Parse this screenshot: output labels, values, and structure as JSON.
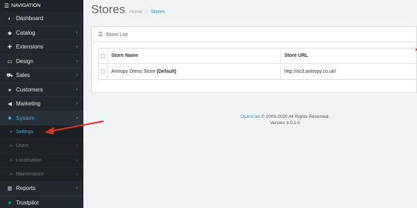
{
  "nav": {
    "header": "NAVIGATION",
    "items": [
      {
        "label": "Dashboard",
        "icon": "dashboard-icon",
        "glyph": "◐",
        "chevron": ""
      },
      {
        "label": "Catalog",
        "icon": "tag-icon",
        "glyph": "◆",
        "chevron": "›"
      },
      {
        "label": "Extensions",
        "icon": "puzzle-icon",
        "glyph": "✚",
        "chevron": "›"
      },
      {
        "label": "Design",
        "icon": "monitor-icon",
        "glyph": "▭",
        "chevron": "›"
      },
      {
        "label": "Sales",
        "icon": "cart-icon",
        "glyph": "⛟",
        "chevron": "›"
      },
      {
        "label": "Customers",
        "icon": "user-icon",
        "glyph": "●",
        "chevron": "›"
      },
      {
        "label": "Marketing",
        "icon": "share-icon",
        "glyph": "◀",
        "chevron": "›"
      },
      {
        "label": "System",
        "icon": "gear-icon",
        "glyph": "✹",
        "chevron": "›"
      }
    ],
    "system_sub": [
      {
        "label": "Settings",
        "chevron": ""
      },
      {
        "label": "Users",
        "chevron": "›"
      },
      {
        "label": "Localisation",
        "chevron": "›"
      },
      {
        "label": "Maintenance",
        "chevron": "›"
      }
    ],
    "bottom": [
      {
        "label": "Reports",
        "icon": "bar-chart-icon",
        "glyph": "▥",
        "chevron": "›"
      },
      {
        "label": "Trustpilot",
        "icon": "star-icon",
        "glyph": "★",
        "chevron": ""
      }
    ]
  },
  "page": {
    "title": "Stores",
    "breadcrumb": [
      "Home",
      "Stores"
    ]
  },
  "panel": {
    "heading": "Store List",
    "columns": [
      "Store Name",
      "Store URL"
    ],
    "rows": [
      {
        "name": "Antropy Demo Store",
        "suffix": "(Default)",
        "url": "http://oc3.antropy.co.uk/"
      }
    ]
  },
  "footer": {
    "link": "OpenCart",
    "copyright": "© 2009-2020 All Rights Reserved.",
    "version": "Version 3.0.2.0"
  },
  "colors": {
    "sidebar": "#23282e",
    "accent": "#4aa3df",
    "annotation": "#d9332b"
  }
}
